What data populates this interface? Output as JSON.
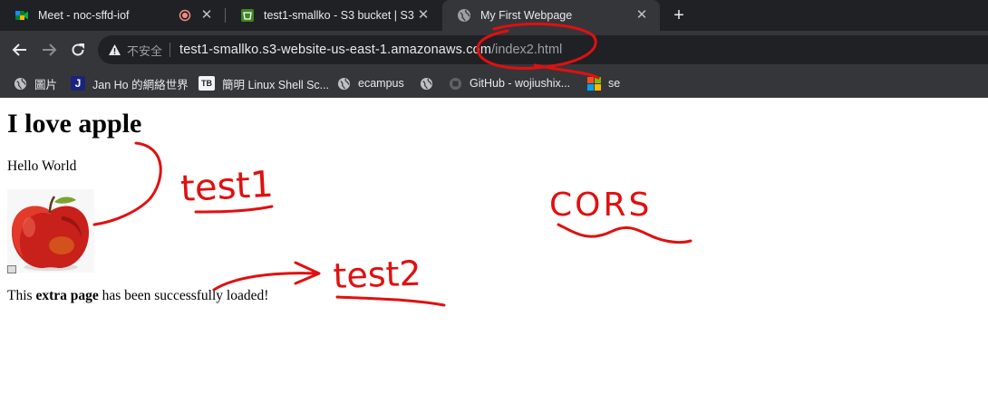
{
  "tabs": [
    {
      "title": "Meet - noc-sffd-iof"
    },
    {
      "title": "test1-smallko - S3 bucket | S3"
    },
    {
      "title": "My First Webpage"
    }
  ],
  "omnibox": {
    "security": "不安全",
    "host": "test1-smallko.s3-website-us-east-1.amazonaws.com",
    "path": "/index2.html"
  },
  "bookmarks": [
    {
      "label": "圖片"
    },
    {
      "label": "Jan Ho 的網絡世界"
    },
    {
      "label": "簡明 Linux Shell Sc..."
    },
    {
      "label": "ecampus"
    },
    {
      "label": ""
    },
    {
      "label": "GitHub - wojiushix..."
    },
    {
      "label": "se"
    }
  ],
  "page": {
    "heading": "I love apple",
    "greeting": "Hello World",
    "sentence_start": "This ",
    "sentence_bold": "extra page",
    "sentence_end": " has been successfully loaded!"
  },
  "annotations": {
    "test1": "test1",
    "test2": "test2",
    "cors": "CORS"
  },
  "colors": {
    "tabstrip": "#202124",
    "toolbar": "#35363a",
    "ink": "#e01010"
  }
}
